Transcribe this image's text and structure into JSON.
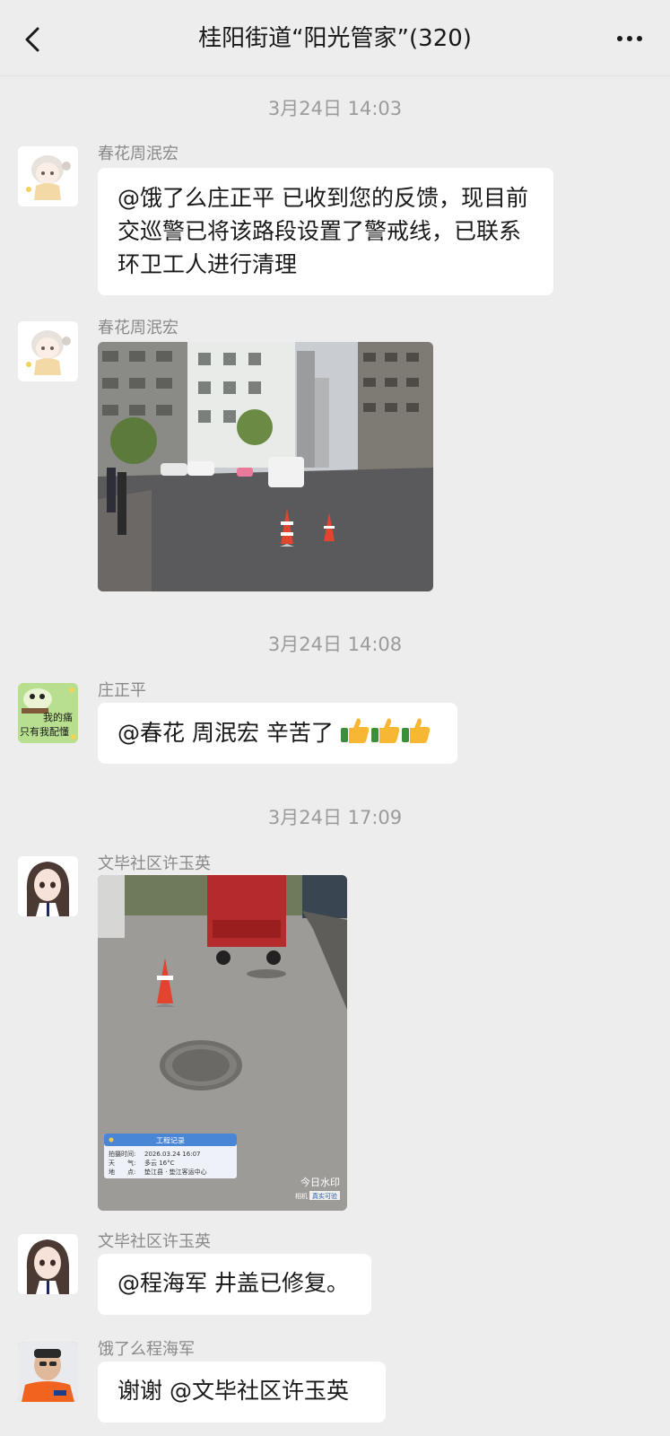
{
  "header": {
    "title": "桂阳街道“阳光管家”(320)"
  },
  "timestamps": [
    "3月24日 14:03",
    "3月24日 14:08",
    "3月24日 17:09"
  ],
  "messages": [
    {
      "sender": "春花周泯宏",
      "text": "@饿了么庄正平 已收到您的反馈，现目前交巡警已将该路段设置了警戒线，已联系环卫工人进行清理"
    },
    {
      "sender": "春花周泯宏",
      "image": "street-scene-with-traffic-cones"
    },
    {
      "sender": "庄正平",
      "text": "@春花 周泯宏 辛苦了",
      "emoji": "👍👍👍",
      "avatar_text_1": "我的痛",
      "avatar_text_2": "只有我配懂"
    },
    {
      "sender": "文毕社区许玉英",
      "image": "repaired-manhole-cover",
      "watermark": {
        "title": "工程记录",
        "time_label": "拍摄时间:",
        "time_value": "2026.03.24 16:07",
        "weather_label": "天　　气:",
        "weather_value": "多云 16°C",
        "place_label": "地　　点:",
        "place_value": "垫江县 · 垫江客运中心",
        "brand": "今日水印",
        "brand_sub_1": "相机",
        "brand_sub_2": "真实可验"
      }
    },
    {
      "sender": "文毕社区许玉英",
      "text": "@程海军 井盖已修复。"
    },
    {
      "sender": "饿了么程海军",
      "text": "谢谢 @文毕社区许玉英"
    }
  ],
  "colors": {
    "background": "#ededed",
    "bubble": "#ffffff",
    "meta_text": "#9b9b9b"
  }
}
